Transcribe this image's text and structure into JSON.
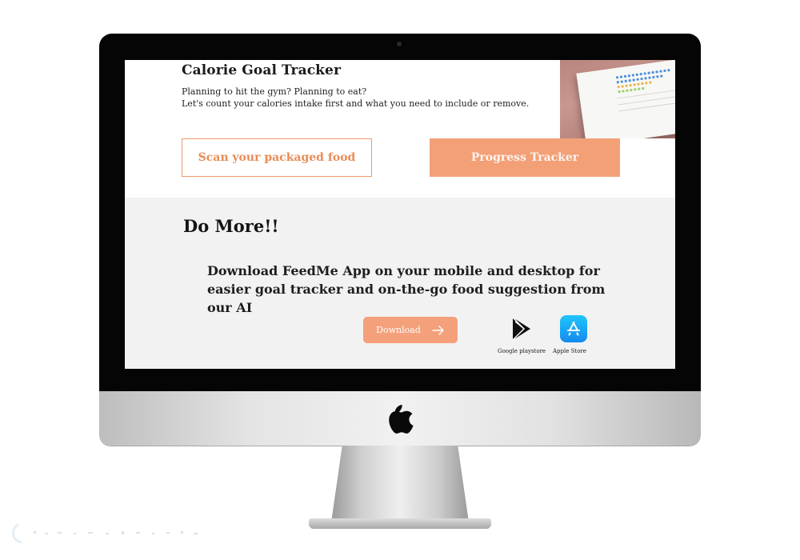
{
  "app": {
    "title": "Calorie Goal Tracker",
    "intro_line_1": "Planning to hit the gym?  Planning to eat?",
    "intro_line_2": "Let's count your calories intake first and what you need to include or remove."
  },
  "actions": {
    "scan_label": "Scan your packaged food",
    "progress_label": "Progress Tracker"
  },
  "do_more": {
    "title": "Do More!!",
    "description": "Download FeedMe App on your mobile and desktop for easier goal tracker and on-the-go food suggestion from our AI",
    "download_label": "Download",
    "stores": [
      {
        "label": "Google playstore",
        "icon": "google-play-icon"
      },
      {
        "label": "Apple Store",
        "icon": "app-store-icon"
      }
    ]
  },
  "colors": {
    "accent": "#f3a077",
    "accent_text": "#ea8b55",
    "section_bg": "#f2f2f2",
    "bezel": "#050505"
  }
}
